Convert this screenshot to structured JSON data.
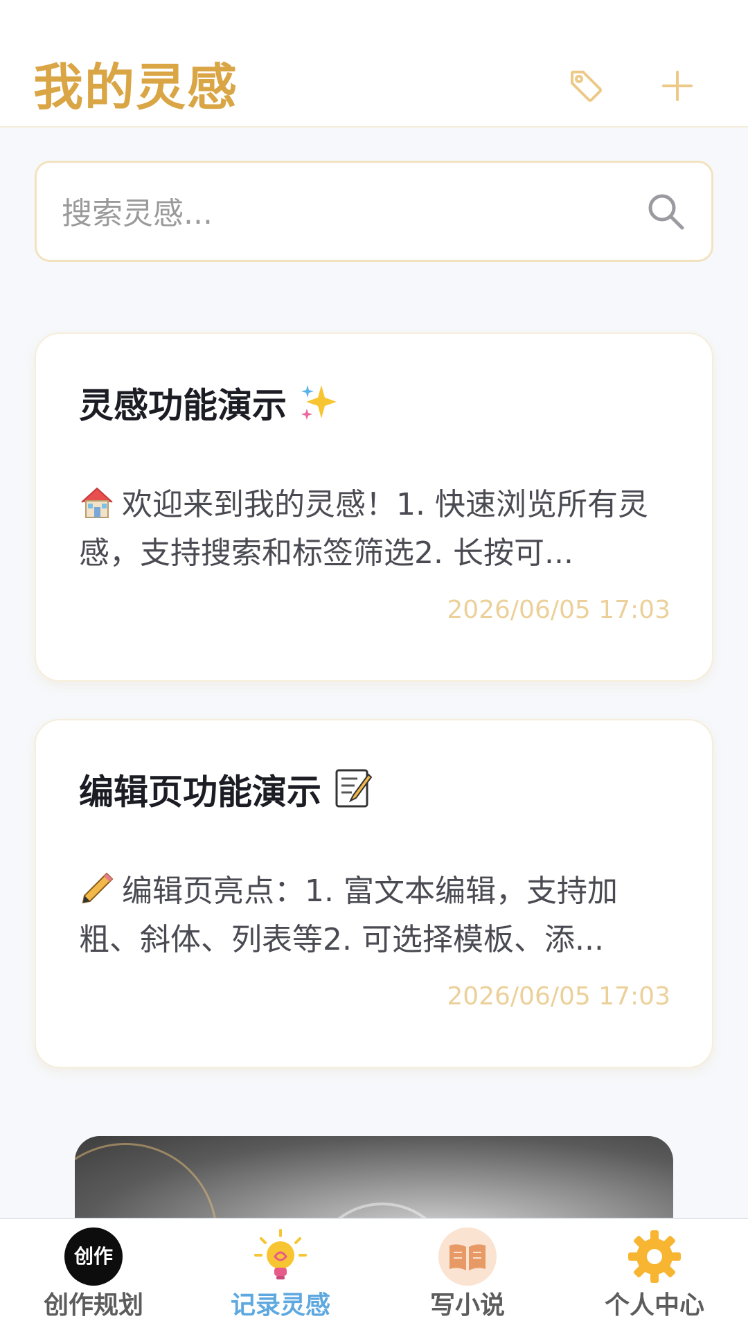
{
  "header": {
    "title": "我的灵感",
    "tag_icon": "tag-icon",
    "add_icon": "plus-icon"
  },
  "search": {
    "placeholder": "搜索灵感...",
    "value": "",
    "icon": "search-icon"
  },
  "cards": [
    {
      "title": "灵感功能演示",
      "title_emoji": "sparkles-icon",
      "lead_icon": "house-icon",
      "body": "欢迎来到我的灵感！1. 快速浏览所有灵感，支持搜索和标签筛选2. 长按可...",
      "date": "2026/06/05 17:03"
    },
    {
      "title": "编辑页功能演示",
      "title_emoji": "memo-icon",
      "lead_icon": "pencil-icon",
      "body": "编辑页亮点：1. 富文本编辑，支持加粗、斜体、列表等2. 可选择模板、添...",
      "date": "2026/06/05 17:03"
    }
  ],
  "tabbar": {
    "items": [
      {
        "label": "创作规划",
        "icon_text": "创作",
        "icon": "create-icon",
        "active": false
      },
      {
        "label": "记录灵感",
        "icon": "lightbulb-icon",
        "active": true
      },
      {
        "label": "写小说",
        "icon": "book-icon",
        "active": false
      },
      {
        "label": "个人中心",
        "icon": "gear-icon",
        "active": false
      }
    ]
  },
  "colors": {
    "accent": "#d9a545",
    "active_tab": "#5ea8e0",
    "date": "#ecd09a"
  }
}
